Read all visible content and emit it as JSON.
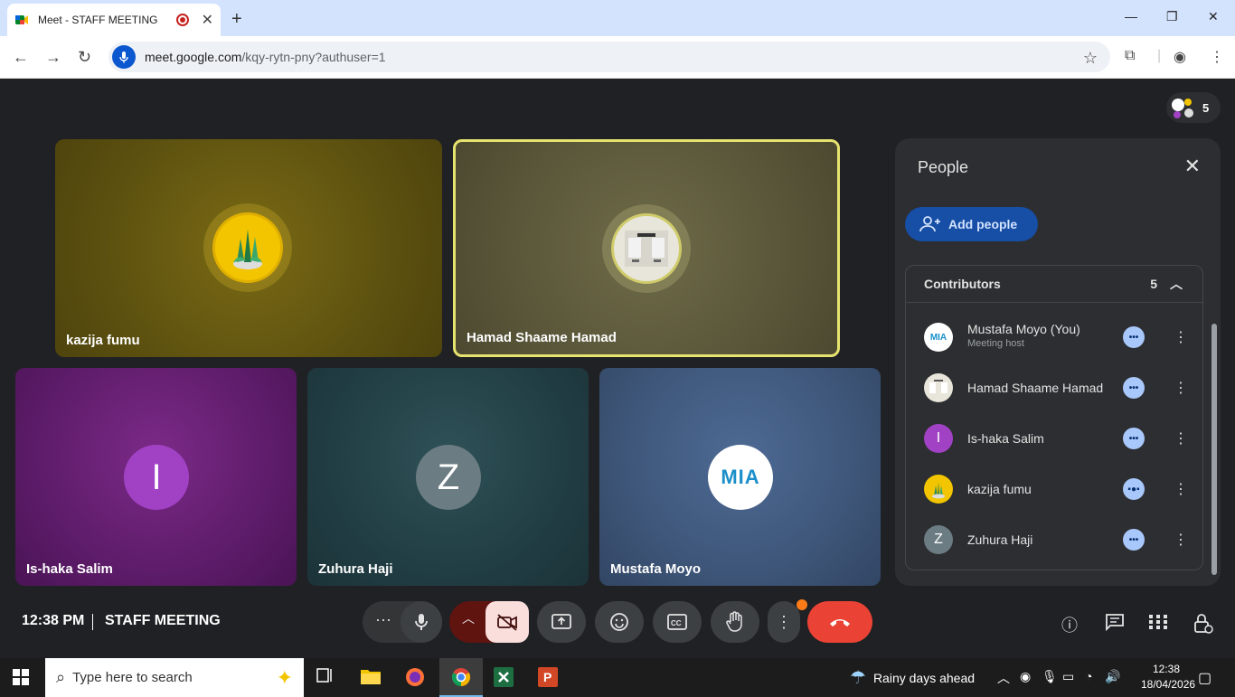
{
  "browser": {
    "tab_title": "Meet - STAFF MEETING",
    "new_tab": "+",
    "url_host": "meet.google.com",
    "url_path": "/kqy-rytn-pny?authuser=1"
  },
  "meeting": {
    "participant_count": "5",
    "tiles": [
      {
        "name": "kazija fumu"
      },
      {
        "name": "Hamad Shaame Hamad"
      },
      {
        "name": "Is-haka Salim",
        "initial": "I"
      },
      {
        "name": "Zuhura Haji",
        "initial": "Z"
      },
      {
        "name": "Mustafa Moyo",
        "logo": "MIA"
      }
    ],
    "time": "12:38 PM",
    "title": "STAFF MEETING"
  },
  "people_panel": {
    "title": "People",
    "add_people": "Add people",
    "section": "Contributors",
    "section_count": "5",
    "people": [
      {
        "name": "Mustafa Moyo (You)",
        "sub": "Meeting host",
        "avatar": "MIA"
      },
      {
        "name": "Hamad Shaame Hamad"
      },
      {
        "name": "Is-haka Salim",
        "avatar": "I"
      },
      {
        "name": "kazija fumu"
      },
      {
        "name": "Zuhura Haji",
        "avatar": "Z"
      }
    ]
  },
  "taskbar": {
    "search_placeholder": "Type here to search",
    "weather": "Rainy days ahead",
    "clock_time": "12:38",
    "clock_date": "18/04/2026"
  },
  "colors": {
    "accent": "#a8c7fa",
    "end_call": "#ea4335",
    "active_speaker": "#e7e36f"
  }
}
